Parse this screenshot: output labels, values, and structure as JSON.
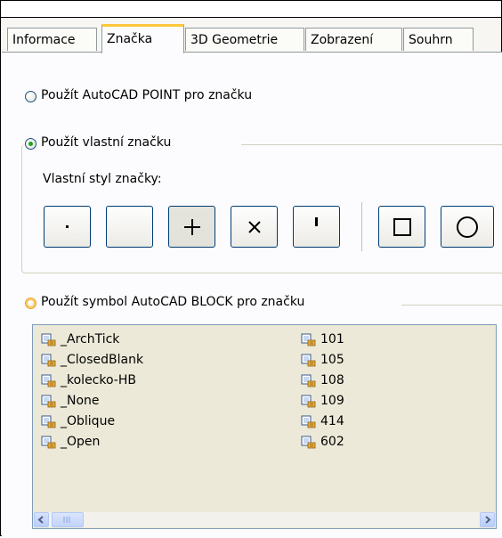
{
  "tabs": [
    {
      "label": "Informace"
    },
    {
      "label": "Značka"
    },
    {
      "label": "3D Geometrie"
    },
    {
      "label": "Zobrazení"
    },
    {
      "label": "Souhrn"
    }
  ],
  "active_tab": "Značka",
  "options": {
    "autocad_point_label": "Použít AutoCAD POINT pro značku",
    "custom_marker_label": "Použít vlastní značku",
    "custom_style_label": "Vlastní styl značky:",
    "block_symbol_label": "Použít symbol AutoCAD BLOCK pro značku"
  },
  "selected_option": "custom_marker",
  "marker_buttons": [
    {
      "name": "dot",
      "selected": false
    },
    {
      "name": "none",
      "selected": false
    },
    {
      "name": "plus",
      "selected": true
    },
    {
      "name": "cross",
      "selected": false
    },
    {
      "name": "tick",
      "selected": false
    },
    {
      "name": "square",
      "selected": false
    },
    {
      "name": "circle",
      "selected": false
    }
  ],
  "blocks": {
    "column1": [
      "_ArchTick",
      "_ClosedBlank",
      "_kolecko-HB",
      "_None",
      "_Oblique",
      "_Open"
    ],
    "column2": [
      "101",
      "105",
      "108",
      "109",
      "414",
      "602"
    ]
  },
  "icons": {
    "block_item": "block-reference-icon",
    "scroll_left": "arrow-left-icon",
    "scroll_right": "arrow-right-icon"
  },
  "colors": {
    "active_tab_accent": "#ffc83c",
    "radio_selected": "#21a121",
    "list_background": "#ece9d8",
    "scroll_accent": "#4d6185"
  }
}
